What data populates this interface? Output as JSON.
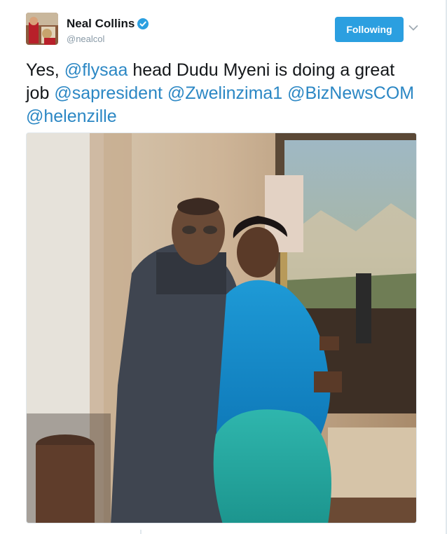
{
  "author": {
    "name": "Neal Collins",
    "handle": "@nealcol",
    "verified_icon": "verified-badge-icon"
  },
  "follow_button": {
    "label": "Following"
  },
  "menu": {
    "icon": "chevron-down-icon"
  },
  "tweet": {
    "segments": [
      {
        "text": "Yes, ",
        "type": "text"
      },
      {
        "text": "@flysaa",
        "type": "mention"
      },
      {
        "text": " head Dudu Myeni is doing a great job ",
        "type": "text"
      },
      {
        "text": "@sapresident",
        "type": "mention"
      },
      {
        "text": " ",
        "type": "text"
      },
      {
        "text": "@Zwelinzima1",
        "type": "mention"
      },
      {
        "text": " ",
        "type": "text"
      },
      {
        "text": "@BizNewsCOM",
        "type": "mention"
      },
      {
        "text": " ",
        "type": "text"
      },
      {
        "text": "@helenzille",
        "type": "mention"
      }
    ]
  },
  "colors": {
    "accent": "#2b9fe0",
    "mention": "#2b87c4",
    "handle": "#8899a6",
    "text": "#14171a"
  }
}
